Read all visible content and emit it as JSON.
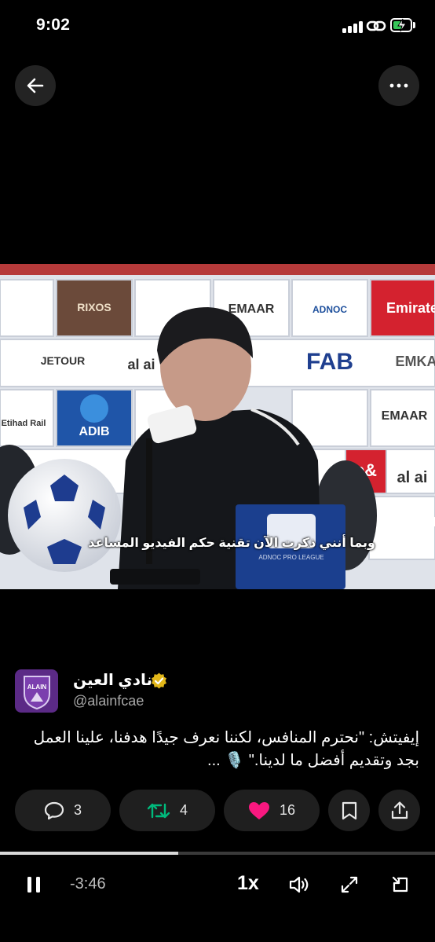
{
  "status_bar": {
    "time": "9:02",
    "battery_level": 0.5,
    "battery_color": "#35c759"
  },
  "nav": {
    "back_icon": "arrow-left-icon",
    "more_icon": "more-horizontal-icon"
  },
  "video": {
    "caption": "وبما أنني ذكرت الآن تقنية حكم الفيديو المساعد",
    "sponsor_boards": [
      "Emirates",
      "EMAAR",
      "FAB",
      "ADIB",
      "JETOUR",
      "RIXOS HOTELS",
      "ADNOC",
      "al ain",
      "Etihad Rail",
      "e&",
      "EMKA"
    ]
  },
  "author": {
    "name": "نادي العين",
    "handle": "@alainfcae",
    "avatar_text": "ALAIN FC",
    "verified_color": "#e2b719"
  },
  "tweet": {
    "line1": "إيفيتش: \"نحترم المنافس، لكننا نعرف جيدًا هدفنا، علينا العمل",
    "line2": "بجد وتقديم أفضل ما لدينا.\" 🎙️ ..."
  },
  "actions": {
    "replies": "3",
    "reposts": "4",
    "likes": "16",
    "like_color": "#f91880",
    "repost_color": "#00ba7c"
  },
  "player": {
    "progress": 0.41,
    "remaining": "-3:46",
    "speed": "1x"
  }
}
